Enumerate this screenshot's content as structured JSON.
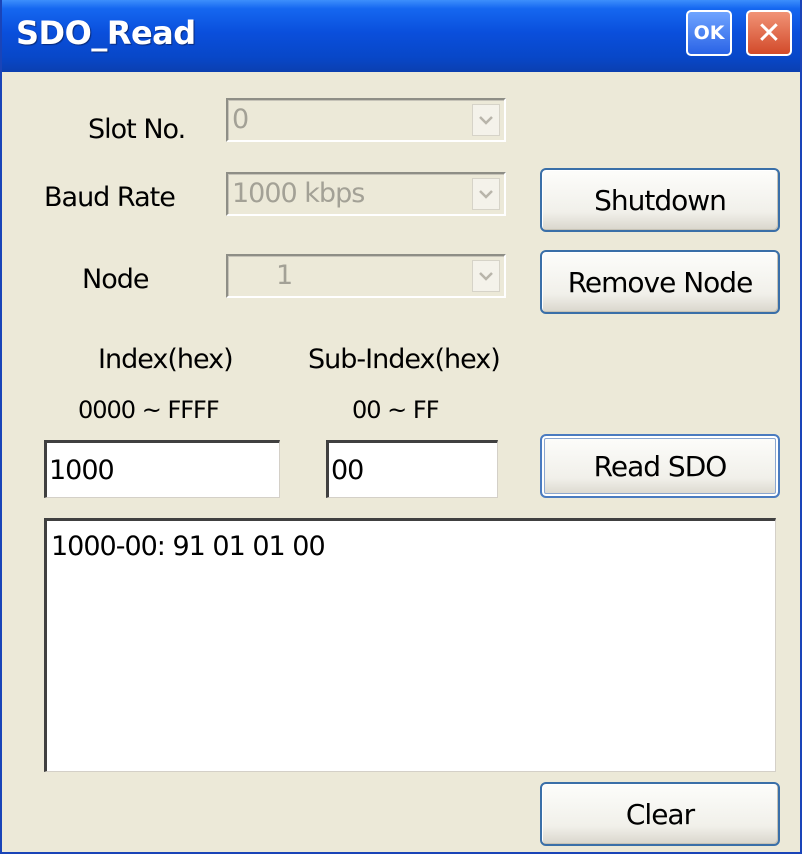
{
  "window": {
    "title": "SDO_Read",
    "ok_label": "OK",
    "close_label": "✕"
  },
  "form": {
    "slot": {
      "label": "Slot No.",
      "value": "0"
    },
    "baud": {
      "label": "Baud Rate",
      "value": "1000 kbps"
    },
    "node": {
      "label": "Node",
      "value": "1"
    },
    "index": {
      "label": "Index(hex)",
      "range": "0000 ~ FFFF",
      "value": "1000"
    },
    "subindex": {
      "label": "Sub-Index(hex)",
      "range": "00 ~ FF",
      "value": "00"
    }
  },
  "buttons": {
    "shutdown": "Shutdown",
    "remove_node": "Remove Node",
    "read_sdo": "Read SDO",
    "clear": "Clear"
  },
  "output": {
    "lines": [
      "1000-00: 91 01 01 00"
    ]
  },
  "icons": {
    "dropdown": "chevron-down-icon",
    "close": "close-icon"
  }
}
